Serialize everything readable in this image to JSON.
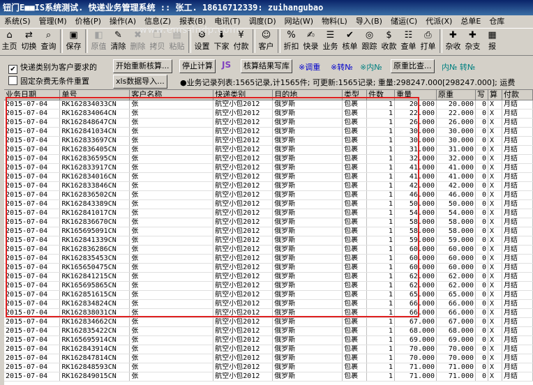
{
  "window": {
    "title": "钮门E■■IS系统测试.  快递业务管理系统  ::  张工. 18616712339: zuihangubao"
  },
  "menu": [
    "系统(S)",
    "管理(M)",
    "价格(P)",
    "操作(A)",
    "信息(Z)",
    "报表(B)",
    "电讯(T)",
    "调度(D)",
    "网站(W)",
    "物料(L)",
    "导入(B)",
    "储运(C)",
    "代派(X)",
    "总单E",
    "仓库"
  ],
  "watermark": "www.ems-help.com",
  "toolbar": [
    {
      "label": "主页",
      "icon": "home-icon",
      "glyph": "⌂",
      "enabled": true
    },
    {
      "label": "切换",
      "icon": "switch-icon",
      "glyph": "⇄",
      "enabled": true
    },
    {
      "label": "查询",
      "icon": "search-icon",
      "glyph": "⌕",
      "enabled": true
    },
    {
      "label": "保存",
      "icon": "save-icon",
      "glyph": "▣",
      "enabled": true
    },
    {
      "label": "原值",
      "icon": "revert-icon",
      "glyph": "◧",
      "enabled": false
    },
    {
      "label": "清除",
      "icon": "clear-icon",
      "glyph": "✎",
      "enabled": true
    },
    {
      "label": "删除",
      "icon": "delete-icon",
      "glyph": "✖",
      "enabled": false
    },
    {
      "label": "拷贝",
      "icon": "copy-icon",
      "glyph": "❐",
      "enabled": false
    },
    {
      "label": "粘贴",
      "icon": "paste-icon",
      "glyph": "▤",
      "enabled": false
    },
    {
      "label": "设置",
      "icon": "settings-icon",
      "glyph": "⚙",
      "enabled": true
    },
    {
      "label": "下家",
      "icon": "downstream-icon",
      "glyph": "⬇",
      "enabled": true
    },
    {
      "label": "付款",
      "icon": "payment-icon",
      "glyph": "¥",
      "enabled": true
    },
    {
      "label": "客户",
      "icon": "customer-icon",
      "glyph": "☺",
      "enabled": true
    },
    {
      "label": "折扣",
      "icon": "discount-icon",
      "glyph": "%",
      "enabled": true
    },
    {
      "label": "快录",
      "icon": "quick-entry-icon",
      "glyph": "✍",
      "enabled": true
    },
    {
      "label": "业务",
      "icon": "business-icon",
      "glyph": "☰",
      "enabled": true
    },
    {
      "label": "核单",
      "icon": "verify-icon",
      "glyph": "✔",
      "enabled": true
    },
    {
      "label": "跟踪",
      "icon": "track-icon",
      "glyph": "◎",
      "enabled": true
    },
    {
      "label": "收款",
      "icon": "receive-icon",
      "glyph": "$",
      "enabled": true
    },
    {
      "label": "查单",
      "icon": "query-order-icon",
      "glyph": "☷",
      "enabled": true
    },
    {
      "label": "打单",
      "icon": "print-icon",
      "glyph": "⎙",
      "enabled": true
    },
    {
      "label": "杂收",
      "icon": "misc-receive-icon",
      "glyph": "✚",
      "enabled": true
    },
    {
      "label": "杂支",
      "icon": "misc-pay-icon",
      "glyph": "✚",
      "enabled": true
    },
    {
      "label": "报",
      "icon": "report-icon",
      "glyph": "▦",
      "enabled": true
    }
  ],
  "controls": {
    "chk_customer_req": "快递类别为客户要求的",
    "chk_fixed_fee": "固定杂费无条件重置",
    "btn_recheck": "开始重新核算...",
    "btn_stop": "停止计算",
    "btn_write": "核算结果写库",
    "lbl_adjust": "※调重",
    "lbl_turn": "※转№",
    "lbl_inner": "※内№",
    "btn_compare": "原重比查...",
    "lbl_inner_turn": "内№ 转№",
    "btn_xls": "xls数据导入...",
    "status": "●业务记录列表:1565记录,计1565件; 可更新:1565记录; 重量:298247.000[298247.000]; 运费"
  },
  "table": {
    "headers": [
      "业务日期",
      "单号",
      "客户名称",
      "快递类别",
      "目的地",
      "类型",
      "件数",
      "重量",
      "原重",
      "写",
      "算",
      "付款"
    ],
    "rows": [
      [
        "2015-07-04",
        "RK162834033CN",
        "张",
        "航空小包2012",
        "俄罗斯",
        "包裹",
        "1",
        "20.000",
        "20.000",
        "0",
        "X",
        "月结"
      ],
      [
        "2015-07-04",
        "RK162834064CN",
        "张",
        "航空小包2012",
        "俄罗斯",
        "包裹",
        "1",
        "22.000",
        "22.000",
        "0",
        "X",
        "月结"
      ],
      [
        "2015-07-04",
        "RK162848647CN",
        "张",
        "航空小包2012",
        "俄罗斯",
        "包裹",
        "1",
        "26.000",
        "26.000",
        "0",
        "X",
        "月结"
      ],
      [
        "2015-07-04",
        "RK162841034CN",
        "张",
        "航空小包2012",
        "俄罗斯",
        "包裹",
        "1",
        "30.000",
        "30.000",
        "0",
        "X",
        "月结"
      ],
      [
        "2015-07-04",
        "RK162833697CN",
        "张",
        "航空小包2012",
        "俄罗斯",
        "包裹",
        "1",
        "30.000",
        "30.000",
        "0",
        "X",
        "月结"
      ],
      [
        "2015-07-04",
        "RK162836405CN",
        "张",
        "航空小包2012",
        "俄罗斯",
        "包裹",
        "1",
        "31.000",
        "31.000",
        "0",
        "X",
        "月结"
      ],
      [
        "2015-07-04",
        "RK162836595CN",
        "张",
        "航空小包2012",
        "俄罗斯",
        "包裹",
        "1",
        "32.000",
        "32.000",
        "0",
        "X",
        "月结"
      ],
      [
        "2015-07-04",
        "RK162833917CN",
        "张",
        "航空小包2012",
        "俄罗斯",
        "包裹",
        "1",
        "41.000",
        "41.000",
        "0",
        "X",
        "月结"
      ],
      [
        "2015-07-04",
        "RK162834016CN",
        "张",
        "航空小包2012",
        "俄罗斯",
        "包裹",
        "1",
        "41.000",
        "41.000",
        "0",
        "X",
        "月结"
      ],
      [
        "2015-07-04",
        "RK162833846CN",
        "张",
        "航空小包2012",
        "俄罗斯",
        "包裹",
        "1",
        "42.000",
        "42.000",
        "0",
        "X",
        "月结"
      ],
      [
        "2015-07-04",
        "RK162836502CN",
        "张",
        "航空小包2012",
        "俄罗斯",
        "包裹",
        "1",
        "46.000",
        "46.000",
        "0",
        "X",
        "月结"
      ],
      [
        "2015-07-04",
        "RK162843389CN",
        "张",
        "航空小包2012",
        "俄罗斯",
        "包裹",
        "1",
        "50.000",
        "50.000",
        "0",
        "X",
        "月结"
      ],
      [
        "2015-07-04",
        "RK162841017CN",
        "张",
        "航空小包2012",
        "俄罗斯",
        "包裹",
        "1",
        "54.000",
        "54.000",
        "0",
        "X",
        "月结"
      ],
      [
        "2015-07-04",
        "RK162836670CN",
        "张",
        "航空小包2012",
        "俄罗斯",
        "包裹",
        "1",
        "58.000",
        "58.000",
        "0",
        "X",
        "月结"
      ],
      [
        "2015-07-04",
        "RK165695091CN",
        "张",
        "航空小包2012",
        "俄罗斯",
        "包裹",
        "1",
        "58.000",
        "58.000",
        "0",
        "X",
        "月结"
      ],
      [
        "2015-07-04",
        "RK162841339CN",
        "张",
        "航空小包2012",
        "俄罗斯",
        "包裹",
        "1",
        "59.000",
        "59.000",
        "0",
        "X",
        "月结"
      ],
      [
        "2015-07-04",
        "RK162836286CN",
        "张",
        "航空小包2012",
        "俄罗斯",
        "包裹",
        "1",
        "60.000",
        "60.000",
        "0",
        "X",
        "月结"
      ],
      [
        "2015-07-04",
        "RK162835453CN",
        "张",
        "航空小包2012",
        "俄罗斯",
        "包裹",
        "1",
        "60.000",
        "60.000",
        "0",
        "X",
        "月结"
      ],
      [
        "2015-07-04",
        "RK165650475CN",
        "张",
        "航空小包2012",
        "俄罗斯",
        "包裹",
        "1",
        "60.000",
        "60.000",
        "0",
        "X",
        "月结"
      ],
      [
        "2015-07-04",
        "RK162841215CN",
        "张",
        "航空小包2012",
        "俄罗斯",
        "包裹",
        "1",
        "62.000",
        "62.000",
        "0",
        "X",
        "月结"
      ],
      [
        "2015-07-04",
        "RK165695865CN",
        "张",
        "航空小包2012",
        "俄罗斯",
        "包裹",
        "1",
        "62.000",
        "62.000",
        "0",
        "X",
        "月结"
      ],
      [
        "2015-07-04",
        "RK162851615CN",
        "张",
        "航空小包2012",
        "俄罗斯",
        "包裹",
        "1",
        "65.000",
        "65.000",
        "0",
        "X",
        "月结"
      ],
      [
        "2015-07-04",
        "RK162834824CN",
        "张",
        "航空小包2012",
        "俄罗斯",
        "包裹",
        "1",
        "66.000",
        "66.000",
        "0",
        "X",
        "月结"
      ],
      [
        "2015-07-04",
        "RK162838031CN",
        "张",
        "航空小包2012",
        "俄罗斯",
        "包裹",
        "1",
        "66.000",
        "66.000",
        "0",
        "X",
        "月结"
      ],
      [
        "2015-07-04",
        "RK162834662CN",
        "张",
        "航空小包2012",
        "俄罗斯",
        "包裹",
        "1",
        "67.000",
        "67.000",
        "0",
        "X",
        "月结"
      ],
      [
        "2015-07-04",
        "RK162835422CN",
        "张",
        "航空小包2012",
        "俄罗斯",
        "包裹",
        "1",
        "68.000",
        "68.000",
        "0",
        "X",
        "月结"
      ],
      [
        "2015-07-04",
        "RK165695914CN",
        "张",
        "航空小包2012",
        "俄罗斯",
        "包裹",
        "1",
        "69.000",
        "69.000",
        "0",
        "X",
        "月结"
      ],
      [
        "2015-07-04",
        "RK162843914CN",
        "张",
        "航空小包2012",
        "俄罗斯",
        "包裹",
        "1",
        "70.000",
        "70.000",
        "0",
        "X",
        "月结"
      ],
      [
        "2015-07-04",
        "RK162847814CN",
        "张",
        "航空小包2012",
        "俄罗斯",
        "包裹",
        "1",
        "70.000",
        "70.000",
        "0",
        "X",
        "月结"
      ],
      [
        "2015-07-04",
        "RK162848593CN",
        "张",
        "航空小包2012",
        "俄罗斯",
        "包裹",
        "1",
        "71.000",
        "71.000",
        "0",
        "X",
        "月结"
      ],
      [
        "2015-07-04",
        "RK162849015CN",
        "张",
        "航空小包2012",
        "俄罗斯",
        "包裹",
        "1",
        "71.000",
        "71.000",
        "0",
        "X",
        "月结"
      ]
    ]
  }
}
